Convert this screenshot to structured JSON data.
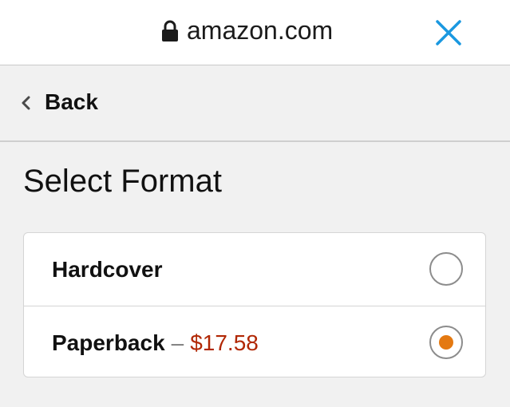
{
  "browser": {
    "domain": "amazon.com",
    "lock_icon": "lock-icon",
    "close_icon": "close-icon",
    "close_color": "#1a98e0"
  },
  "nav": {
    "back_label": "Back",
    "back_icon": "chevron-left-icon"
  },
  "page": {
    "title": "Select Format"
  },
  "formats": [
    {
      "label": "Hardcover",
      "selected": false
    },
    {
      "label": "Paperback",
      "separator": "–",
      "price": "$17.58",
      "selected": true
    }
  ],
  "colors": {
    "price": "#b12704",
    "radio_selected": "#e47911"
  }
}
